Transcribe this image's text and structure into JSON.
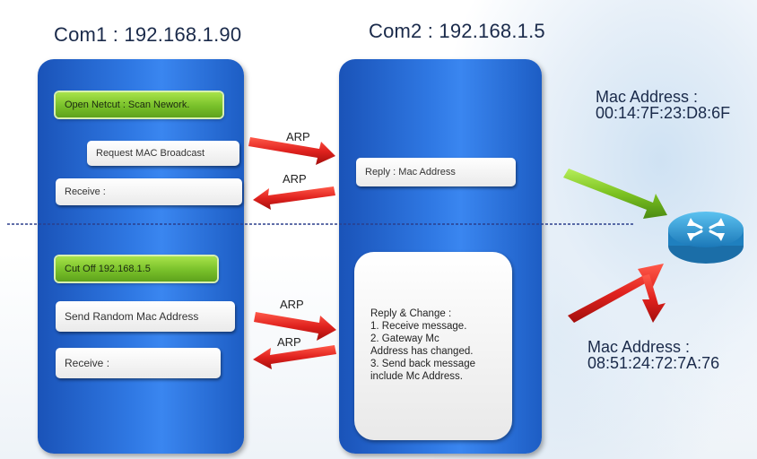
{
  "com1": {
    "title": "Com1 : 192.168.1.90"
  },
  "com2": {
    "title": "Com2 : 192.168.1.5"
  },
  "top_section": {
    "open_netcut": "Open  Netcut : Scan Nework.",
    "request_mac": "Request MAC Broadcast",
    "receive": "Receive :",
    "reply": "Reply : Mac Address",
    "arp_request": "ARP",
    "arp_reply": "ARP"
  },
  "bottom_section": {
    "cut_off": "Cut Off 192.168.1.5",
    "send_random": "Send Random Mac Address",
    "receive": "Receive :",
    "arp_request": "ARP",
    "arp_reply": "ARP",
    "reply_change_lines": [
      "Reply & Change :",
      "1. Receive message.",
      "2. Gateway Mc",
      "Address has changed.",
      "3. Send back message",
      "include Mc Address."
    ]
  },
  "router_mac_top": {
    "label": "Mac Address :",
    "value": "00:14:7F:23:D8:6F"
  },
  "router_mac_bottom": {
    "label": "Mac Address :",
    "value": "08:51:24:72:7A:76"
  },
  "icons": {
    "router": "router-icon"
  },
  "colors": {
    "panel": "#2f78e3",
    "green_box": "#78c02a",
    "red_arrow": "#e0221e",
    "green_arrow": "#7cc221",
    "router": "#2a9ad6"
  }
}
